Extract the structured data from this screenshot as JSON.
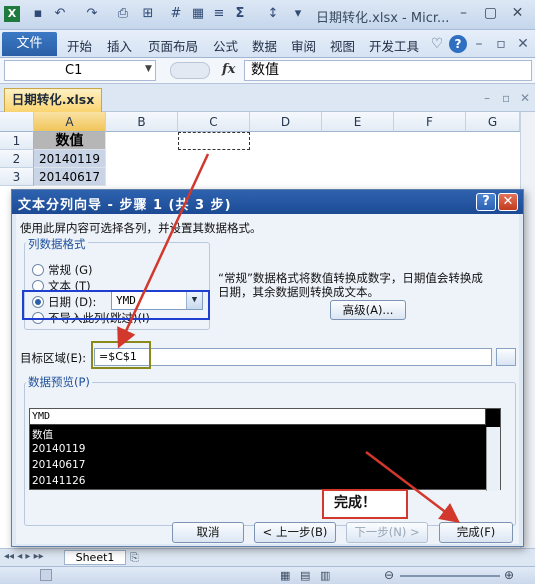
{
  "app": {
    "title": "日期转化.xlsx - Micr...",
    "file_tab": "文件",
    "tabs": [
      "开始",
      "插入",
      "页面布局",
      "公式",
      "数据",
      "审阅",
      "视图",
      "开发工具"
    ]
  },
  "formula_bar": {
    "name_box": "C1",
    "fx": "fx",
    "formula": "数值"
  },
  "workbook_tab": "日期转化.xlsx",
  "grid": {
    "columns": [
      "A",
      "B",
      "C",
      "D",
      "E",
      "F",
      "G"
    ],
    "rows": [
      "1",
      "2",
      "3"
    ],
    "cells": [
      "数值",
      "20140119",
      "20140617"
    ]
  },
  "sheet_tab": "Sheet1",
  "dialog": {
    "title": "文本分列向导 - 步骤 1 (共 3 步)",
    "help_label": "?",
    "close_label": "✕",
    "instruction": "使用此屏内容可选择各列，并设置其数据格式。",
    "format_group_label": "列数据格式",
    "formats": [
      "常规 (G)",
      "文本 (T)",
      "日期 (D):",
      "不导入此列(跳过)(I)"
    ],
    "date_value": "YMD",
    "description_line1": "“常规”数据格式将数值转换成数字，日期值会转换成",
    "description_line2": "日期，其余数据则转换成文本。",
    "advanced_button": "高级(A)...",
    "dest_label": "目标区域(E):",
    "dest_value": "=$C$1",
    "preview_label": "数据预览(P)",
    "preview_header": "YMD",
    "preview_rows": [
      "数值",
      "20140119",
      "20140617",
      "20141126"
    ],
    "cancel_button": "取消",
    "back_button": "< 上一步(B)",
    "next_button": "下一步(N) >",
    "finish_button": "完成(F)"
  },
  "annotation": {
    "done_text": "完成！"
  },
  "colors": {
    "dialog_title": "#1c4a94",
    "highlight_blue": "#1e3fcf",
    "highlight_olive": "#8a8a1a",
    "arrow_red": "#d2382c"
  }
}
